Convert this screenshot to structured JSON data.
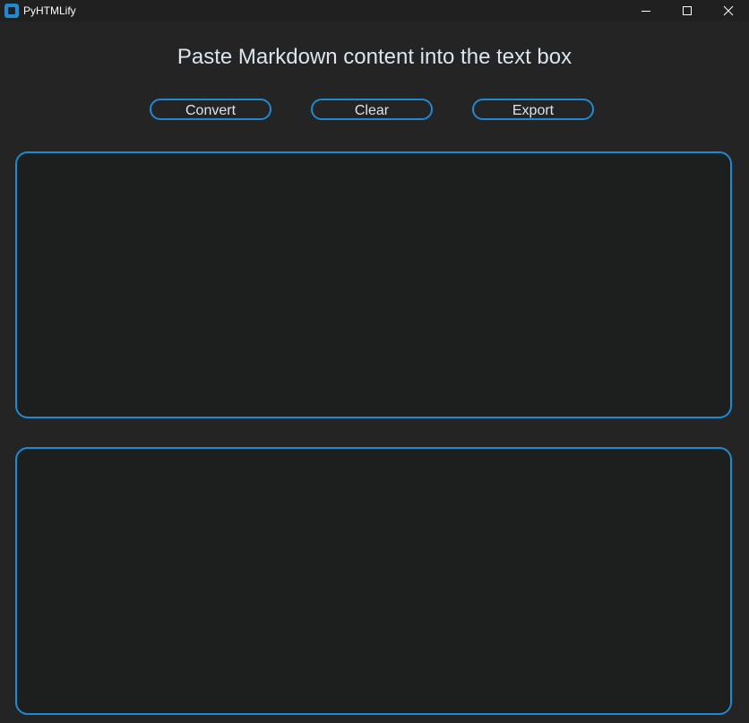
{
  "window": {
    "title": "PyHTMLify",
    "icon": "app-icon",
    "controls": [
      "minimize-icon",
      "maximize-icon",
      "close-icon"
    ]
  },
  "main": {
    "heading": "Paste Markdown content into the text box",
    "buttons": {
      "convert": "Convert",
      "clear": "Clear",
      "export": "Export"
    },
    "input_box": {
      "value": ""
    },
    "output_box": {
      "value": ""
    }
  },
  "colors": {
    "background": "#242424",
    "titlebar": "#202020",
    "accent": "#1f8ad2",
    "textbox_bg": "#1d1e1e",
    "text": "#dce4ee"
  }
}
